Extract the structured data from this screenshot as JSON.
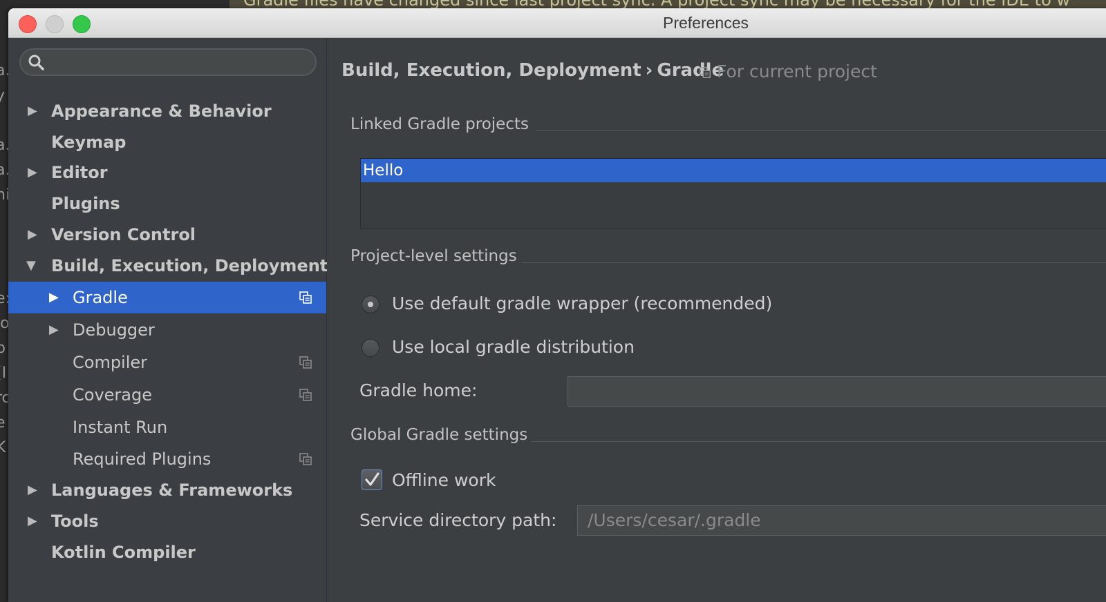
{
  "background": {
    "notice_text": "Gradle files have changed since last project sync. A project sync may be necessary for the IDE to w",
    "gutter_chars": [
      "a.",
      "y",
      "a.",
      "a.",
      "hi",
      ":",
      "e:",
      "lo",
      "p",
      "(I",
      "rc",
      "e",
      "K"
    ]
  },
  "window": {
    "title": "Preferences"
  },
  "sidebar": {
    "search": {
      "value": "",
      "placeholder": ""
    },
    "items": [
      {
        "label": "Appearance & Behavior",
        "expandable": true,
        "expanded": false,
        "level": 0
      },
      {
        "label": "Keymap",
        "expandable": false,
        "level": 0
      },
      {
        "label": "Editor",
        "expandable": true,
        "expanded": false,
        "level": 0
      },
      {
        "label": "Plugins",
        "expandable": false,
        "level": 0
      },
      {
        "label": "Version Control",
        "expandable": true,
        "expanded": false,
        "level": 0
      },
      {
        "label": "Build, Execution, Deployment",
        "expandable": true,
        "expanded": true,
        "level": 0
      },
      {
        "label": "Gradle",
        "expandable": true,
        "expanded": false,
        "level": 1,
        "selected": true,
        "project_scoped": true
      },
      {
        "label": "Debugger",
        "expandable": true,
        "expanded": false,
        "level": 1
      },
      {
        "label": "Compiler",
        "expandable": false,
        "level": 1,
        "project_scoped": true
      },
      {
        "label": "Coverage",
        "expandable": false,
        "level": 1,
        "project_scoped": true
      },
      {
        "label": "Instant Run",
        "expandable": false,
        "level": 1
      },
      {
        "label": "Required Plugins",
        "expandable": false,
        "level": 1,
        "project_scoped": true
      },
      {
        "label": "Languages & Frameworks",
        "expandable": true,
        "expanded": false,
        "level": 0
      },
      {
        "label": "Tools",
        "expandable": true,
        "expanded": false,
        "level": 0
      },
      {
        "label": "Kotlin Compiler",
        "expandable": false,
        "level": 0
      }
    ]
  },
  "content": {
    "breadcrumb": {
      "parent": "Build, Execution, Deployment",
      "separator": "›",
      "current": "Gradle"
    },
    "scope_label": "For current project",
    "linked_projects": {
      "header": "Linked Gradle projects",
      "items": [
        "Hello"
      ]
    },
    "project_settings": {
      "header": "Project-level settings",
      "option_default": "Use default gradle wrapper (recommended)",
      "option_local": "Use local gradle distribution",
      "selected_option": "default",
      "gradle_home_label": "Gradle home:",
      "gradle_home_value": ""
    },
    "global_settings": {
      "header": "Global Gradle settings",
      "offline_label": "Offline work",
      "offline_checked": true,
      "service_dir_label": "Service directory path:",
      "service_dir_value": "/Users/cesar/.gradle"
    }
  },
  "colors": {
    "selection": "#2f65ca",
    "panel": "#3c3f41",
    "sidebar": "#3b3f43"
  }
}
